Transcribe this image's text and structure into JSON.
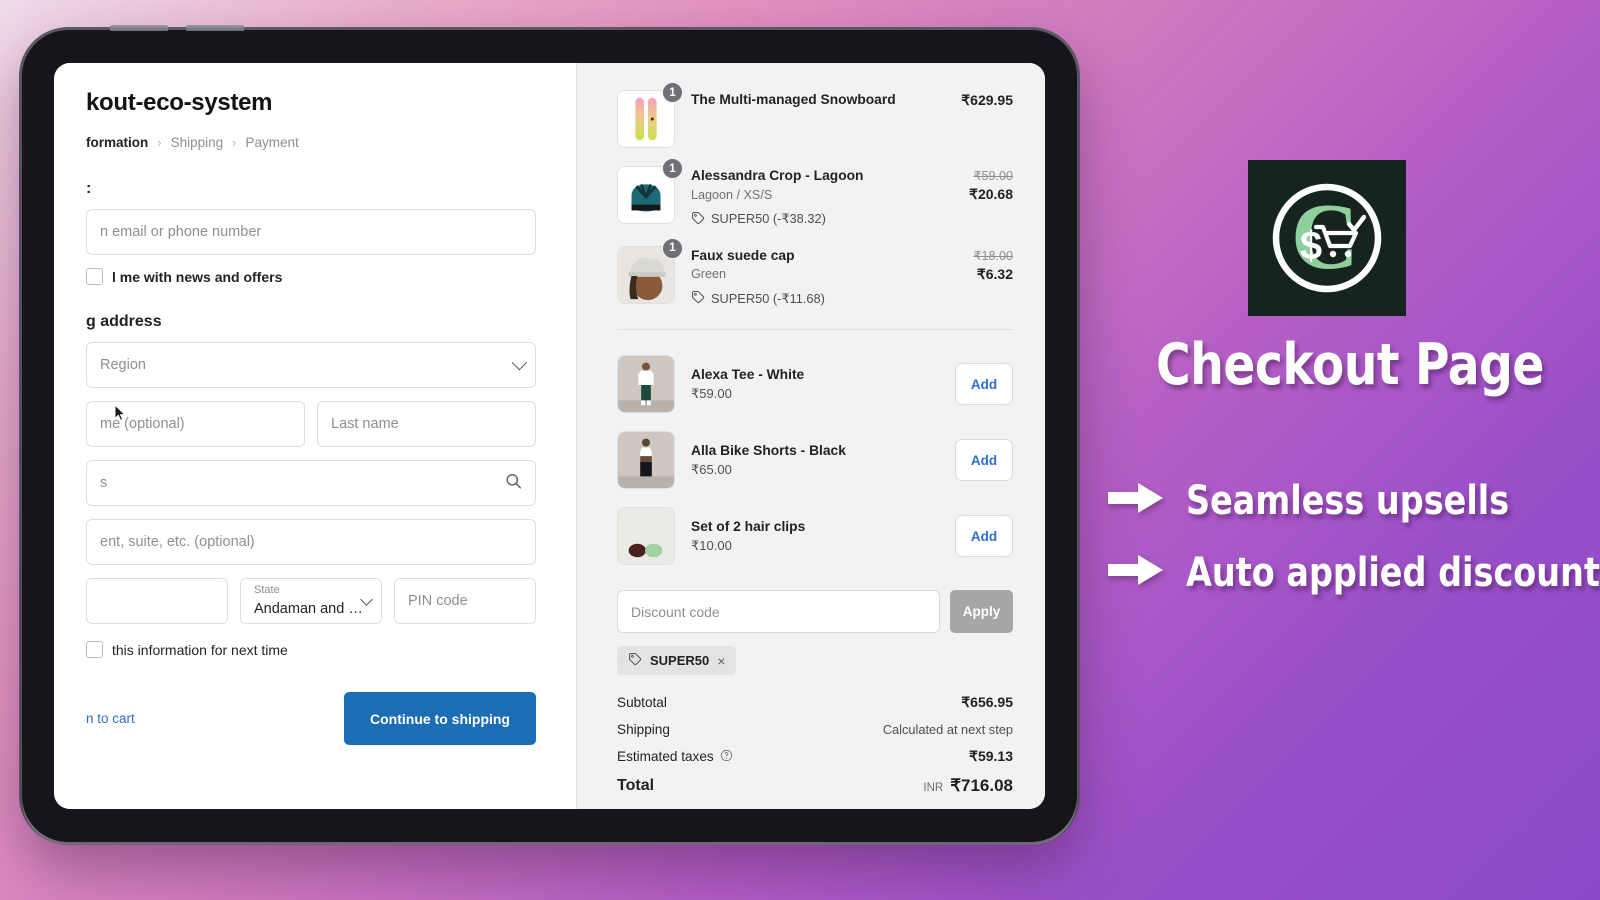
{
  "checkout": {
    "shop_title": "kout-eco-system",
    "breadcrumb": [
      {
        "label": "formation",
        "active": true
      },
      {
        "label": "Shipping",
        "active": false
      },
      {
        "label": "Payment",
        "active": false
      }
    ],
    "breadcrumb_separator": "›",
    "contact": {
      "heading": ":",
      "email_placeholder": "n email or phone number",
      "newsletter_label": "l me with news and offers"
    },
    "shipping": {
      "heading": "g address",
      "country_placeholder": "Region",
      "first_name_placeholder": "me (optional)",
      "last_name_placeholder": "Last name",
      "address_placeholder": "s",
      "apartment_placeholder": "ent, suite, etc. (optional)",
      "city_placeholder": "",
      "state_label": "State",
      "state_value": "Andaman and Nico...",
      "pin_placeholder": "PIN code",
      "save_info_label": "this information for next time"
    },
    "footer": {
      "back_link": "n to cart",
      "continue_button": "Continue to shipping"
    }
  },
  "summary": {
    "cart_items": [
      {
        "name": "The Multi-managed Snowboard",
        "variant": "",
        "qty": "1",
        "price": "₹629.95",
        "original_price": "",
        "discount": "",
        "icon": "snowboard-thumbnail"
      },
      {
        "name": "Alessandra Crop - Lagoon",
        "variant": "Lagoon / XS/S",
        "qty": "1",
        "price": "₹20.68",
        "original_price": "₹59.00",
        "discount": "SUPER50 (-₹38.32)",
        "icon": "sports-bra-thumbnail"
      },
      {
        "name": "Faux suede cap",
        "variant": "Green",
        "qty": "1",
        "price": "₹6.32",
        "original_price": "₹18.00",
        "discount": "SUPER50 (-₹11.68)",
        "icon": "cap-thumbnail"
      }
    ],
    "upsells": [
      {
        "name": "Alexa Tee - White",
        "price": "₹59.00",
        "add_label": "Add",
        "icon": "tee-thumbnail"
      },
      {
        "name": "Alla Bike Shorts - Black",
        "price": "₹65.00",
        "add_label": "Add",
        "icon": "shorts-thumbnail"
      },
      {
        "name": "Set of 2 hair clips",
        "price": "₹10.00",
        "add_label": "Add",
        "icon": "hairclips-thumbnail"
      }
    ],
    "discount": {
      "input_placeholder": "Discount code",
      "apply_label": "Apply",
      "applied_code": "SUPER50",
      "remove_label": "×"
    },
    "totals": [
      {
        "label": "Subtotal",
        "value": "₹656.95",
        "muted": false,
        "info": false
      },
      {
        "label": "Shipping",
        "value": "Calculated at next step",
        "muted": true,
        "info": false
      },
      {
        "label": "Estimated taxes",
        "value": "₹59.13",
        "muted": false,
        "info": true
      }
    ],
    "grand_total": {
      "label": "Total",
      "currency": "INR",
      "value": "₹716.08"
    }
  },
  "promo": {
    "title": "Checkout Page",
    "bullets": [
      "Seamless upsells",
      "Auto applied discount"
    ],
    "logo": {
      "letter": "C",
      "symbol": "$",
      "background": "#16231f",
      "letter_color": "#8fcf9e"
    }
  },
  "colors": {
    "primary_button": "#1b6eb4",
    "link": "#2c6ecb",
    "apply_disabled": "#a6a6a6",
    "summary_bg": "#f2f2f2",
    "gradient_start": "#f0dbe9",
    "gradient_end": "#8a4ac6"
  }
}
